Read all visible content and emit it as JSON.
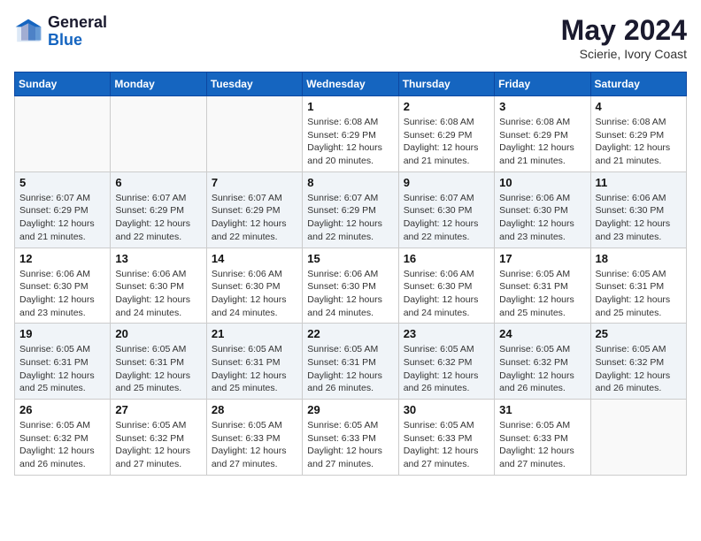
{
  "header": {
    "logo_line1": "General",
    "logo_line2": "Blue",
    "month": "May 2024",
    "location": "Scierie, Ivory Coast"
  },
  "days_of_week": [
    "Sunday",
    "Monday",
    "Tuesday",
    "Wednesday",
    "Thursday",
    "Friday",
    "Saturday"
  ],
  "weeks": [
    [
      {
        "day": "",
        "info": ""
      },
      {
        "day": "",
        "info": ""
      },
      {
        "day": "",
        "info": ""
      },
      {
        "day": "1",
        "info": "Sunrise: 6:08 AM\nSunset: 6:29 PM\nDaylight: 12 hours\nand 20 minutes."
      },
      {
        "day": "2",
        "info": "Sunrise: 6:08 AM\nSunset: 6:29 PM\nDaylight: 12 hours\nand 21 minutes."
      },
      {
        "day": "3",
        "info": "Sunrise: 6:08 AM\nSunset: 6:29 PM\nDaylight: 12 hours\nand 21 minutes."
      },
      {
        "day": "4",
        "info": "Sunrise: 6:08 AM\nSunset: 6:29 PM\nDaylight: 12 hours\nand 21 minutes."
      }
    ],
    [
      {
        "day": "5",
        "info": "Sunrise: 6:07 AM\nSunset: 6:29 PM\nDaylight: 12 hours\nand 21 minutes."
      },
      {
        "day": "6",
        "info": "Sunrise: 6:07 AM\nSunset: 6:29 PM\nDaylight: 12 hours\nand 22 minutes."
      },
      {
        "day": "7",
        "info": "Sunrise: 6:07 AM\nSunset: 6:29 PM\nDaylight: 12 hours\nand 22 minutes."
      },
      {
        "day": "8",
        "info": "Sunrise: 6:07 AM\nSunset: 6:29 PM\nDaylight: 12 hours\nand 22 minutes."
      },
      {
        "day": "9",
        "info": "Sunrise: 6:07 AM\nSunset: 6:30 PM\nDaylight: 12 hours\nand 22 minutes."
      },
      {
        "day": "10",
        "info": "Sunrise: 6:06 AM\nSunset: 6:30 PM\nDaylight: 12 hours\nand 23 minutes."
      },
      {
        "day": "11",
        "info": "Sunrise: 6:06 AM\nSunset: 6:30 PM\nDaylight: 12 hours\nand 23 minutes."
      }
    ],
    [
      {
        "day": "12",
        "info": "Sunrise: 6:06 AM\nSunset: 6:30 PM\nDaylight: 12 hours\nand 23 minutes."
      },
      {
        "day": "13",
        "info": "Sunrise: 6:06 AM\nSunset: 6:30 PM\nDaylight: 12 hours\nand 24 minutes."
      },
      {
        "day": "14",
        "info": "Sunrise: 6:06 AM\nSunset: 6:30 PM\nDaylight: 12 hours\nand 24 minutes."
      },
      {
        "day": "15",
        "info": "Sunrise: 6:06 AM\nSunset: 6:30 PM\nDaylight: 12 hours\nand 24 minutes."
      },
      {
        "day": "16",
        "info": "Sunrise: 6:06 AM\nSunset: 6:30 PM\nDaylight: 12 hours\nand 24 minutes."
      },
      {
        "day": "17",
        "info": "Sunrise: 6:05 AM\nSunset: 6:31 PM\nDaylight: 12 hours\nand 25 minutes."
      },
      {
        "day": "18",
        "info": "Sunrise: 6:05 AM\nSunset: 6:31 PM\nDaylight: 12 hours\nand 25 minutes."
      }
    ],
    [
      {
        "day": "19",
        "info": "Sunrise: 6:05 AM\nSunset: 6:31 PM\nDaylight: 12 hours\nand 25 minutes."
      },
      {
        "day": "20",
        "info": "Sunrise: 6:05 AM\nSunset: 6:31 PM\nDaylight: 12 hours\nand 25 minutes."
      },
      {
        "day": "21",
        "info": "Sunrise: 6:05 AM\nSunset: 6:31 PM\nDaylight: 12 hours\nand 25 minutes."
      },
      {
        "day": "22",
        "info": "Sunrise: 6:05 AM\nSunset: 6:31 PM\nDaylight: 12 hours\nand 26 minutes."
      },
      {
        "day": "23",
        "info": "Sunrise: 6:05 AM\nSunset: 6:32 PM\nDaylight: 12 hours\nand 26 minutes."
      },
      {
        "day": "24",
        "info": "Sunrise: 6:05 AM\nSunset: 6:32 PM\nDaylight: 12 hours\nand 26 minutes."
      },
      {
        "day": "25",
        "info": "Sunrise: 6:05 AM\nSunset: 6:32 PM\nDaylight: 12 hours\nand 26 minutes."
      }
    ],
    [
      {
        "day": "26",
        "info": "Sunrise: 6:05 AM\nSunset: 6:32 PM\nDaylight: 12 hours\nand 26 minutes."
      },
      {
        "day": "27",
        "info": "Sunrise: 6:05 AM\nSunset: 6:32 PM\nDaylight: 12 hours\nand 27 minutes."
      },
      {
        "day": "28",
        "info": "Sunrise: 6:05 AM\nSunset: 6:33 PM\nDaylight: 12 hours\nand 27 minutes."
      },
      {
        "day": "29",
        "info": "Sunrise: 6:05 AM\nSunset: 6:33 PM\nDaylight: 12 hours\nand 27 minutes."
      },
      {
        "day": "30",
        "info": "Sunrise: 6:05 AM\nSunset: 6:33 PM\nDaylight: 12 hours\nand 27 minutes."
      },
      {
        "day": "31",
        "info": "Sunrise: 6:05 AM\nSunset: 6:33 PM\nDaylight: 12 hours\nand 27 minutes."
      },
      {
        "day": "",
        "info": ""
      }
    ]
  ]
}
